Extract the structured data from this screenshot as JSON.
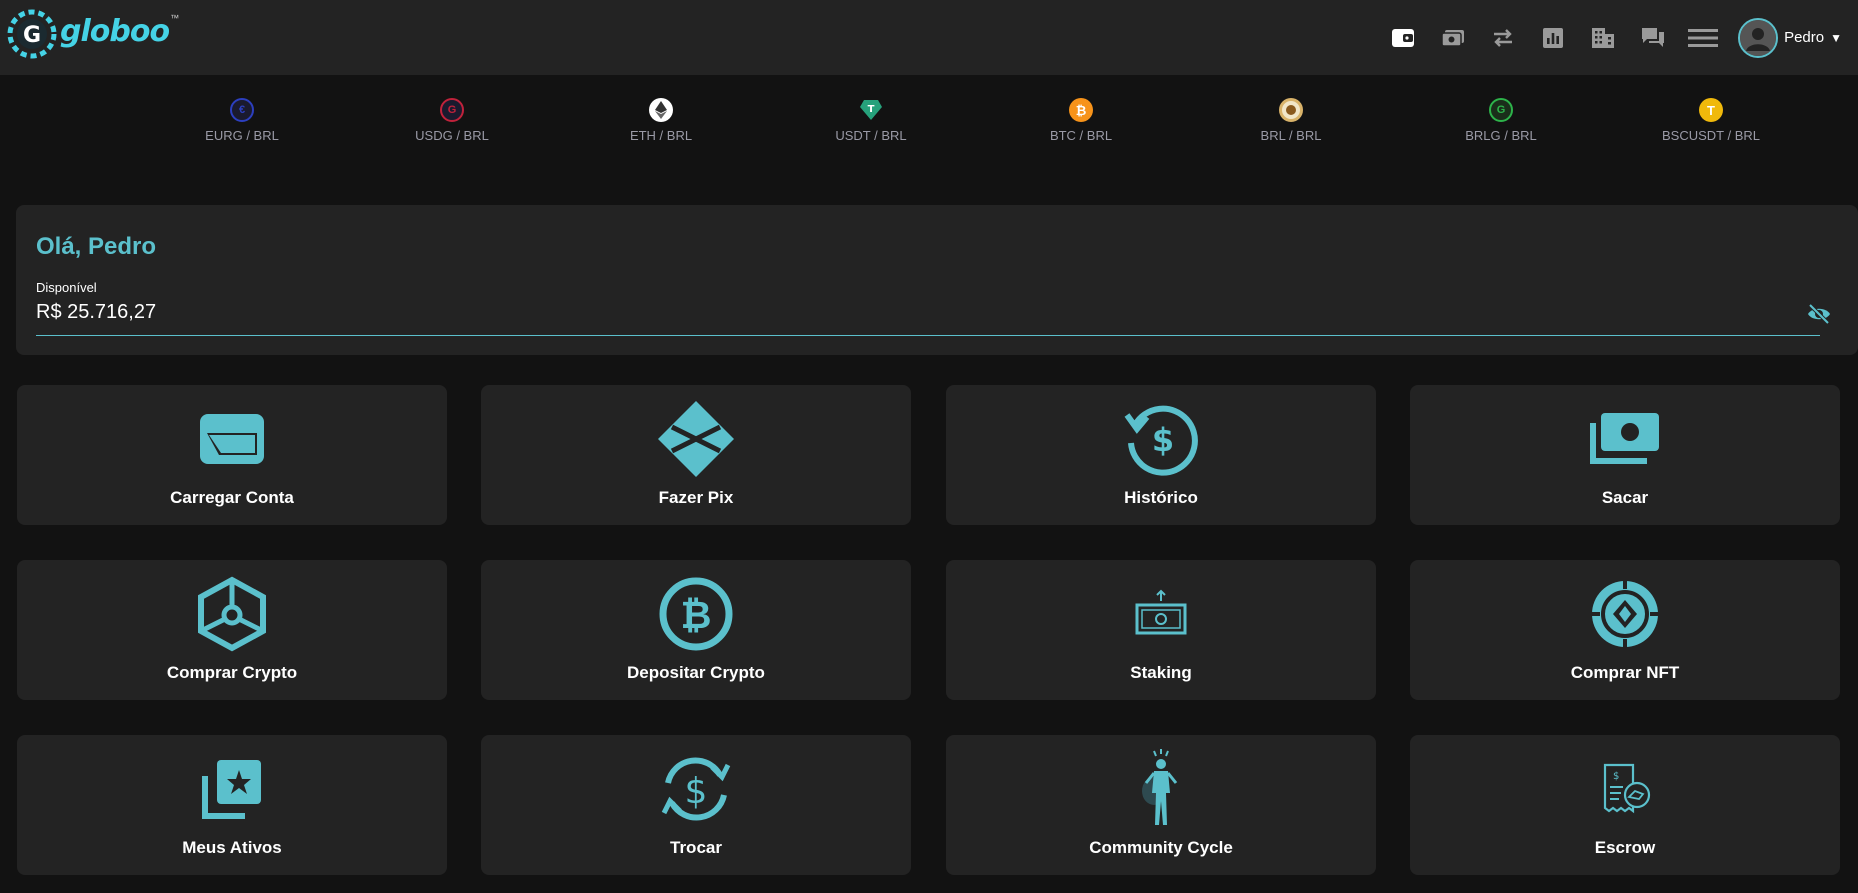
{
  "header": {
    "logo_text": "globoo",
    "logo_tm": "™",
    "nav_icons": [
      "wallet-icon",
      "cash-icon",
      "swap-arrows-icon",
      "chart-icon",
      "building-icon",
      "chat-icon",
      "menu-icon"
    ],
    "user_name": "Pedro"
  },
  "tickers": [
    {
      "pair": "EURG / BRL",
      "icon": "eurg-coin-icon",
      "color": "#2c3fbf"
    },
    {
      "pair": "USDG / BRL",
      "icon": "usdg-coin-icon",
      "color": "#c0223b"
    },
    {
      "pair": "ETH / BRL",
      "icon": "eth-coin-icon",
      "color": "#ffffff"
    },
    {
      "pair": "USDT / BRL",
      "icon": "usdt-coin-icon",
      "color": "#26a17b"
    },
    {
      "pair": "BTC / BRL",
      "icon": "btc-coin-icon",
      "color": "#f7931a"
    },
    {
      "pair": "BRL / BRL",
      "icon": "brl-coin-icon",
      "color": "#d9b36a"
    },
    {
      "pair": "BRLG / BRL",
      "icon": "brlg-coin-icon",
      "color": "#2db34a"
    },
    {
      "pair": "BSCUSDT / BRL",
      "icon": "bscusdt-coin-icon",
      "color": "#f0b90b"
    }
  ],
  "balance": {
    "greeting": "Olá, Pedro",
    "available_label": "Disponível",
    "available_value": "R$ 25.716,27"
  },
  "actions": [
    {
      "label": "Carregar Conta",
      "icon": "card-icon"
    },
    {
      "label": "Fazer Pix",
      "icon": "pix-icon"
    },
    {
      "label": "Histórico",
      "icon": "history-dollar-icon"
    },
    {
      "label": "Sacar",
      "icon": "money-stack-icon"
    },
    {
      "label": "Comprar Crypto",
      "icon": "hexagon-crypto-icon"
    },
    {
      "label": "Depositar Crypto",
      "icon": "bitcoin-circle-icon"
    },
    {
      "label": "Staking",
      "icon": "staking-banknote-icon"
    },
    {
      "label": "Comprar NFT",
      "icon": "nft-chip-icon"
    },
    {
      "label": "Meus Ativos",
      "icon": "star-photos-icon"
    },
    {
      "label": "Trocar",
      "icon": "dollar-exchange-icon"
    },
    {
      "label": "Community Cycle",
      "icon": "person-bag-icon"
    },
    {
      "label": "Escrow",
      "icon": "escrow-receipt-icon"
    }
  ],
  "colors": {
    "accent": "#5bc0cc",
    "background": "#121212",
    "card": "#232323"
  }
}
